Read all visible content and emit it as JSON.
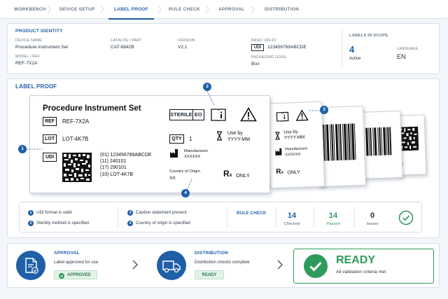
{
  "tabs": [
    {
      "label": "WORKBENCH"
    },
    {
      "label": "DEVICE SETUP"
    },
    {
      "label": "LABEL PROOF"
    },
    {
      "label": "RULE CHECK"
    },
    {
      "label": "APPROVAL"
    },
    {
      "label": "DISTRIBUTION"
    }
  ],
  "identity": {
    "title": "PRODUCT IDENTITY",
    "device_name_label": "DEVICE NAME",
    "device_name": "Procedure Instrument Set",
    "model_label": "MODEL / REF",
    "model": "REF-7X2A",
    "catalog_label": "CATALOG / PART",
    "catalog": "CAT-8842B",
    "version_label": "VERSION",
    "version": "V2.1",
    "udi_di_label": "BASIC UDI-DI",
    "udi_tag": "UDI",
    "udi_di": "123456789ABCDE",
    "packaging_label": "PACKAGING LEVEL",
    "packaging": "Box",
    "scope_title": "LABELS IN SCOPE",
    "scope_count": "4",
    "scope_status": "Active",
    "language_label": "LANGUAGE",
    "language": "EN"
  },
  "proof": {
    "title": "LABEL PROOF",
    "product_name": "Procedure Instrument Set",
    "ref_tag": "REF",
    "ref_value": "REF-7X2A",
    "lot_tag": "LOT",
    "lot_value": "LOT-4K7B",
    "udi_tag": "UDI",
    "hri": [
      "(01)  123456789ABCDE",
      "(11)  240101",
      "(17)  290101",
      "(10)  LOT-4K7B"
    ],
    "sterile_tag": "STERILE",
    "sterile_method": "EO",
    "qty_tag": "QTY",
    "qty_value": "1",
    "use_by_label": "Use by",
    "use_by_value": "YYYY-MM",
    "manufacturer_label": "Manufacturer",
    "manufacturer_value": "XXXXXX",
    "origin_label": "Country of Origin",
    "origin_value": "XX",
    "rx_r": "R",
    "rx_x": "x",
    "rx_only": "ONLY",
    "callouts": [
      "1",
      "2",
      "3",
      "4"
    ]
  },
  "rule_check": {
    "title": "RULE CHECK",
    "results": [
      {
        "n": "1",
        "text": "UDI format is valid"
      },
      {
        "n": "2",
        "text": "Sterility method is specified"
      },
      {
        "n": "3",
        "text": "Caution statement present"
      },
      {
        "n": "4",
        "text": "Country of origin is specified"
      }
    ],
    "checked": "14",
    "checked_label": "Checked",
    "passed": "14",
    "passed_label": "Passed",
    "issues": "0",
    "issues_label": "Issues"
  },
  "approval": {
    "title": "APPROVAL",
    "text": "Label approved for use",
    "badge": "APPROVED"
  },
  "distribution": {
    "title": "DISTRIBUTION",
    "text": "Distribution checks complete",
    "badge": "READY"
  },
  "ready": {
    "title": "READY",
    "text": "All validation criteria met"
  },
  "colors": {
    "primary": "#1f5fa8",
    "success": "#2e9b5c",
    "muted": "#6a7886"
  }
}
